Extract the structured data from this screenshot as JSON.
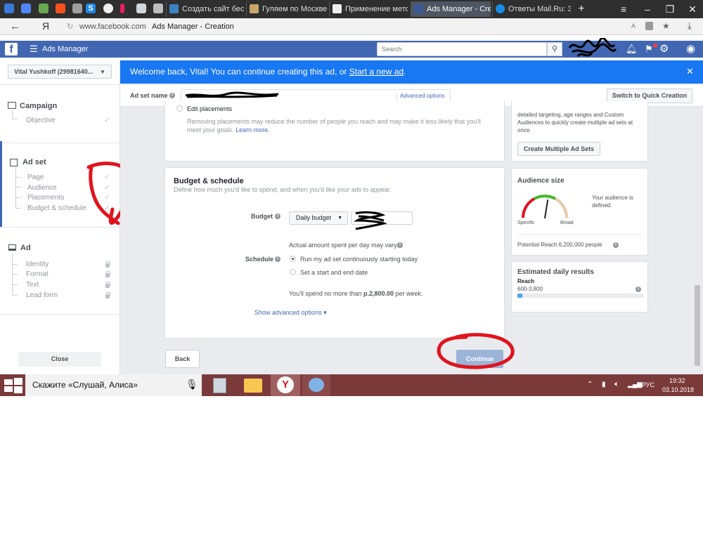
{
  "browser": {
    "tabs": [
      {
        "label": "Создать сайт беспла",
        "active": false
      },
      {
        "label": "Гуляем по Москве",
        "active": false
      },
      {
        "label": "Применение метод",
        "active": false
      },
      {
        "label": "Ads Manager - Cre",
        "active": true
      },
      {
        "label": "Ответы Mail.Ru: Зада",
        "active": false
      }
    ],
    "new_tab": "+",
    "yandex_logo": "Я",
    "url_domain": "www.facebook.com",
    "page_title": "Ads Manager - Creation"
  },
  "fb_header": {
    "logo": "f",
    "app_name": "Ads Manager",
    "search_placeholder": "Search"
  },
  "account": {
    "name": "Vital Yushkoff (29981640..."
  },
  "banner": {
    "text": "Welcome back, Vital! You can continue creating this ad, or ",
    "link": "Start a new ad",
    "end": "."
  },
  "adset_bar": {
    "label": "Ad set name",
    "advanced": "Advanced options",
    "switch": "Switch to Quick Creation"
  },
  "sidebar": {
    "campaign": {
      "title": "Campaign",
      "items": [
        "Objective"
      ]
    },
    "adset": {
      "title": "Ad set",
      "items": [
        "Page",
        "Audience",
        "Placements",
        "Budget & schedule"
      ]
    },
    "ad": {
      "title": "Ad",
      "items": [
        "Identity",
        "Format",
        "Text",
        "Lead form"
      ]
    },
    "close": "Close"
  },
  "placements": {
    "edit": "Edit placements",
    "note": "Removing placements may reduce the number of people you reach and may make it less likely that you'll meet your goals.",
    "learn": "Learn more."
  },
  "budget": {
    "title": "Budget & schedule",
    "subtitle": "Define how much you'd like to spend, and when you'd like your ads to appear.",
    "budget_label": "Budget",
    "budget_type": "Daily budget",
    "actual_note": "Actual amount spent per day may vary.",
    "schedule_label": "Schedule",
    "option1": "Run my ad set continuously starting today",
    "option2": "Set a start and end date",
    "spend_prefix": "You'll spend no more than ",
    "spend_amount": "р.2,800.00",
    "spend_suffix": " per week.",
    "advanced": "Show advanced options ▾"
  },
  "right_panel": {
    "multi_text": "detailed targeting, age ranges and Custom Audiences to quickly create multiple ad sets at once.",
    "multi_btn": "Create Multiple Ad Sets",
    "audience_title": "Audience size",
    "audience_status": "Your audience is defined.",
    "gauge_left": "Specific",
    "gauge_right": "Broad",
    "gauge_level": 0.55,
    "potential": "Potential Reach:6,200,000 people",
    "results_title": "Estimated daily results",
    "reach_label": "Reach",
    "reach_range": "600-3,800",
    "reach_fill": 0.04
  },
  "footer": {
    "back": "Back",
    "continue": "Continue"
  },
  "taskbar": {
    "search": "Скажите «Слушай, Алиса»",
    "lang": "РУС",
    "time": "19:32",
    "date": "03.10.2018"
  },
  "colors": {
    "fb_blue": "#4267b2",
    "banner_blue": "#1877f2",
    "annotation_red": "#e0141e"
  }
}
